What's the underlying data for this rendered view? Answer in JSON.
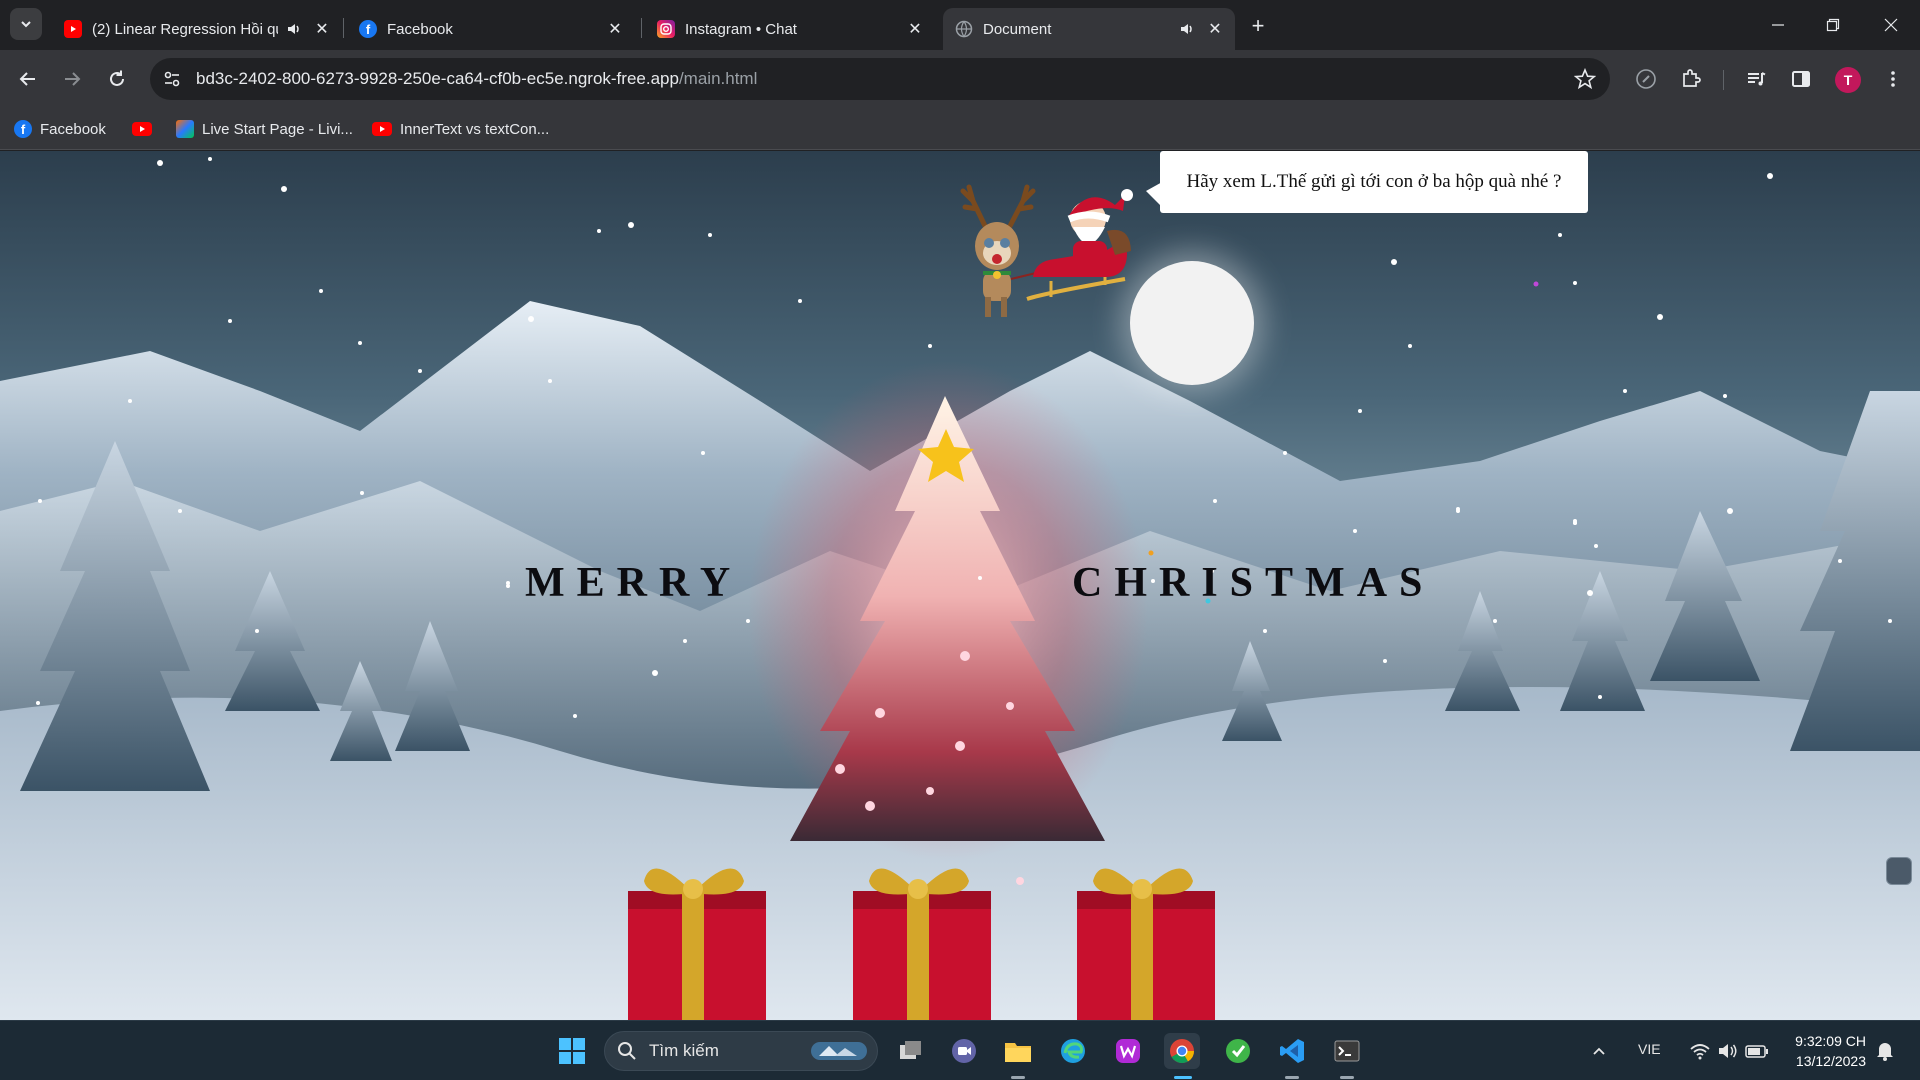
{
  "tabs": [
    {
      "title": "(2) Linear Regression Hồi qu",
      "icon": "youtube-icon",
      "audio": true
    },
    {
      "title": "Facebook",
      "icon": "facebook-icon",
      "audio": false
    },
    {
      "title": "Instagram • Chat",
      "icon": "instagram-icon",
      "audio": false
    },
    {
      "title": "Document",
      "icon": "globe-icon",
      "audio": true,
      "active": true
    }
  ],
  "address": {
    "host": "bd3c-2402-800-6273-9928-250e-ca64-cf0b-ec5e.ngrok-free.app",
    "path": "/main.html"
  },
  "profile": {
    "initial": "T",
    "color": "#c2185b"
  },
  "bookmarks": [
    {
      "label": "Facebook",
      "icon": "facebook-icon"
    },
    {
      "label": "",
      "icon": "youtube-icon"
    },
    {
      "label": "Live Start Page - Livi...",
      "icon": "live-start-icon"
    },
    {
      "label": "InnerText vs textCon...",
      "icon": "youtube-icon"
    }
  ],
  "page": {
    "speech": "Hãy xem L.Thế gửi gì tới con ở ba hộp quà nhé ?",
    "greeting_left": "MERRY",
    "greeting_right": "CHRISTMAS",
    "gift_count": 3
  },
  "taskbar": {
    "search_label": "Tìm kiếm",
    "language": "VIE",
    "time": "9:32:09 CH",
    "date": "13/12/2023"
  },
  "colors": {
    "chrome_dark": "#202124",
    "chrome_toolbar": "#35363a",
    "gift_red": "#c8102e",
    "ribbon_gold": "#d4a62a",
    "star_yellow": "#f7c21b"
  }
}
